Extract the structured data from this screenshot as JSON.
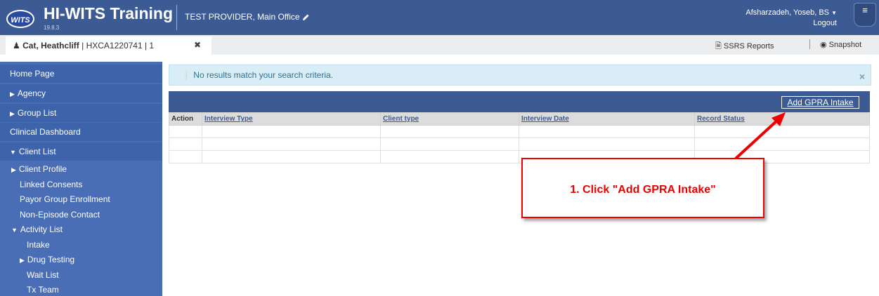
{
  "header": {
    "logo_text": "WITS",
    "app_title": "HI-WITS Training",
    "version": "19.8.3",
    "provider": "TEST PROVIDER, Main Office",
    "user": "Afsharzadeh, Yoseb, BS",
    "logout": "Logout",
    "brand_color": "#3c5b95"
  },
  "client_bar": {
    "client_name": "Cat, Heathcliff",
    "client_id": " | HXCA1220741 | 1",
    "ssrs": "SSRS Reports",
    "snapshot": "Snapshot"
  },
  "sidebar": {
    "items": [
      {
        "label": "Home Page"
      },
      {
        "label": "Agency"
      },
      {
        "label": "Group List"
      },
      {
        "label": "Clinical Dashboard"
      },
      {
        "label": "Client List"
      }
    ],
    "client_sub": [
      {
        "label": "Client Profile"
      },
      {
        "label": "Linked Consents"
      },
      {
        "label": "Payor Group Enrollment"
      },
      {
        "label": "Non-Episode Contact"
      },
      {
        "label": "Activity List"
      }
    ],
    "activity_sub": [
      {
        "label": "Intake"
      },
      {
        "label": "Drug Testing"
      },
      {
        "label": "Wait List"
      },
      {
        "label": "Tx Team"
      }
    ]
  },
  "alert": {
    "message": "No results match your search criteria.",
    "close": "×"
  },
  "grid": {
    "add_button": "Add GPRA Intake",
    "columns": [
      "Action",
      "Interview Type",
      "Client type",
      "Interview Date",
      "Record Status"
    ]
  },
  "annotation": {
    "text": "1. Click \"Add GPRA Intake\""
  }
}
